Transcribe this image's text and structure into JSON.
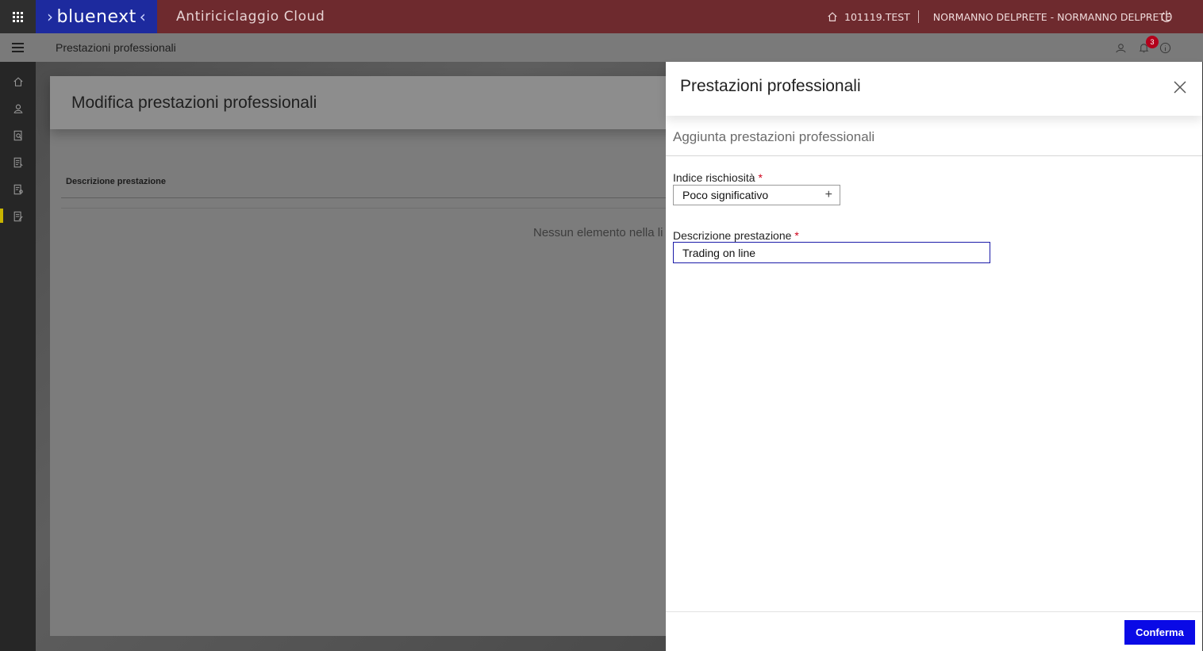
{
  "topbar": {
    "logo_text": "bluenext",
    "logo_left_glyph": "›",
    "logo_right_glyph": "‹",
    "app_title": "Antiriciclaggio Cloud",
    "tenant": "101119.TEST",
    "user": "NORMANNO DELPRETE - NORMANNO DELPRETE"
  },
  "subbar": {
    "breadcrumb": "Prestazioni professionali",
    "notifications_count": "3"
  },
  "sidebar": {
    "items": [
      {
        "icon": "home-icon"
      },
      {
        "icon": "user-icon"
      },
      {
        "icon": "search-doc-icon"
      },
      {
        "icon": "doc-list-icon"
      },
      {
        "icon": "doc-user-icon"
      },
      {
        "icon": "doc-edit-icon",
        "active": true
      }
    ]
  },
  "main": {
    "title": "Modifica prestazioni professionali",
    "table_header": "Descrizione prestazione",
    "empty_text": "Nessun elemento nella li"
  },
  "panel": {
    "title": "Prestazioni professionali",
    "subtitle": "Aggiunta prestazioni professionali",
    "field1_label": "Indice rischiosità",
    "field1_value": "Poco significativo",
    "field2_label": "Descrizione prestazione",
    "field2_value": "Trading on line",
    "required_mark": "*",
    "confirm_label": "Conferma"
  },
  "colors": {
    "topbar": "#6e2a2e",
    "logo_bg": "#1d2a9e",
    "confirm": "#0a0ae6",
    "active_marker": "#c8b400"
  }
}
